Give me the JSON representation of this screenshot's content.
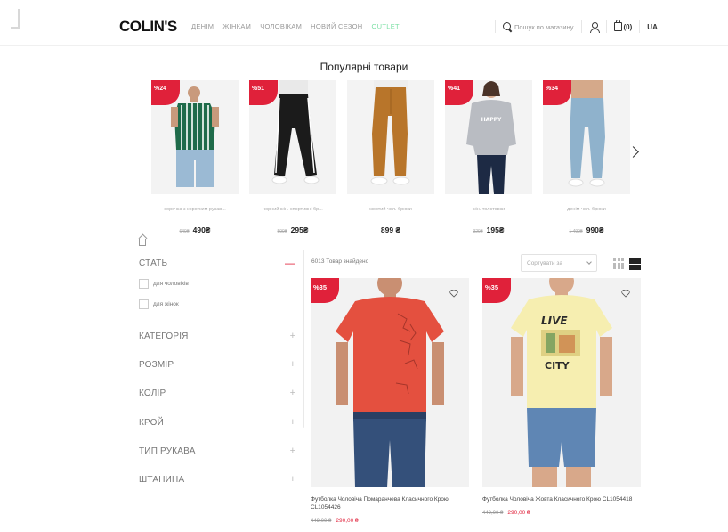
{
  "header": {
    "logo": "COLIN'S",
    "nav": [
      {
        "label": "ДЕНІМ"
      },
      {
        "label": "ЖІНКАМ"
      },
      {
        "label": "ЧОЛОВІКАМ"
      },
      {
        "label": "НОВИЙ СЕЗОН"
      },
      {
        "label": "OUTLET"
      }
    ],
    "search_placeholder": "Пошук по магазину",
    "cart_count": "(0)",
    "language": "UA"
  },
  "popular": {
    "title": "Популярні товари",
    "items": [
      {
        "badge": "%24",
        "name": "сорочка з коротким рукав...",
        "old_price": "649₴",
        "price": "490₴"
      },
      {
        "badge": "%51",
        "name": "чорний жін. спортивні бр...",
        "old_price": "599₴",
        "price": "295₴"
      },
      {
        "badge": "",
        "name": "жовтий чол. брюки",
        "old_price": "",
        "price": "899 ₴"
      },
      {
        "badge": "%41",
        "name": "жін. толстовки",
        "old_price": "329₴",
        "price": "195₴"
      },
      {
        "badge": "%34",
        "name": "денім чол. брюки",
        "old_price": "1 499₴",
        "price": "990₴"
      }
    ]
  },
  "filters": [
    {
      "label": "СТАТЬ",
      "toggle": "—"
    },
    {
      "label": "КАТЕГОРІЯ",
      "toggle": "+"
    },
    {
      "label": "РОЗМІР",
      "toggle": "+"
    },
    {
      "label": "КОЛІР",
      "toggle": "+"
    },
    {
      "label": "КРОЙ",
      "toggle": "+"
    },
    {
      "label": "ТИП РУКАВА",
      "toggle": "+"
    },
    {
      "label": "ШТАНИНА",
      "toggle": "+"
    }
  ],
  "gender_options": [
    {
      "label": "для чоловіків"
    },
    {
      "label": "для жінок"
    }
  ],
  "listing": {
    "found": "6013 Товар знайдено",
    "sort_placeholder": "Сортувати за",
    "products": [
      {
        "badge": "%35",
        "name": "Футболка Чоловіча Помаранчева Класичного Крою CL1054426",
        "old_price": "449,00 ₴",
        "price": "290,00 ₴"
      },
      {
        "badge": "%35",
        "name": "Футболка Чоловіча Жовта Класичного Крою CL1054418",
        "old_price": "449,00 ₴",
        "price": "290,00 ₴"
      }
    ]
  },
  "colors": {
    "accent": "#e0213a",
    "outlet": "#7ee0a6"
  }
}
